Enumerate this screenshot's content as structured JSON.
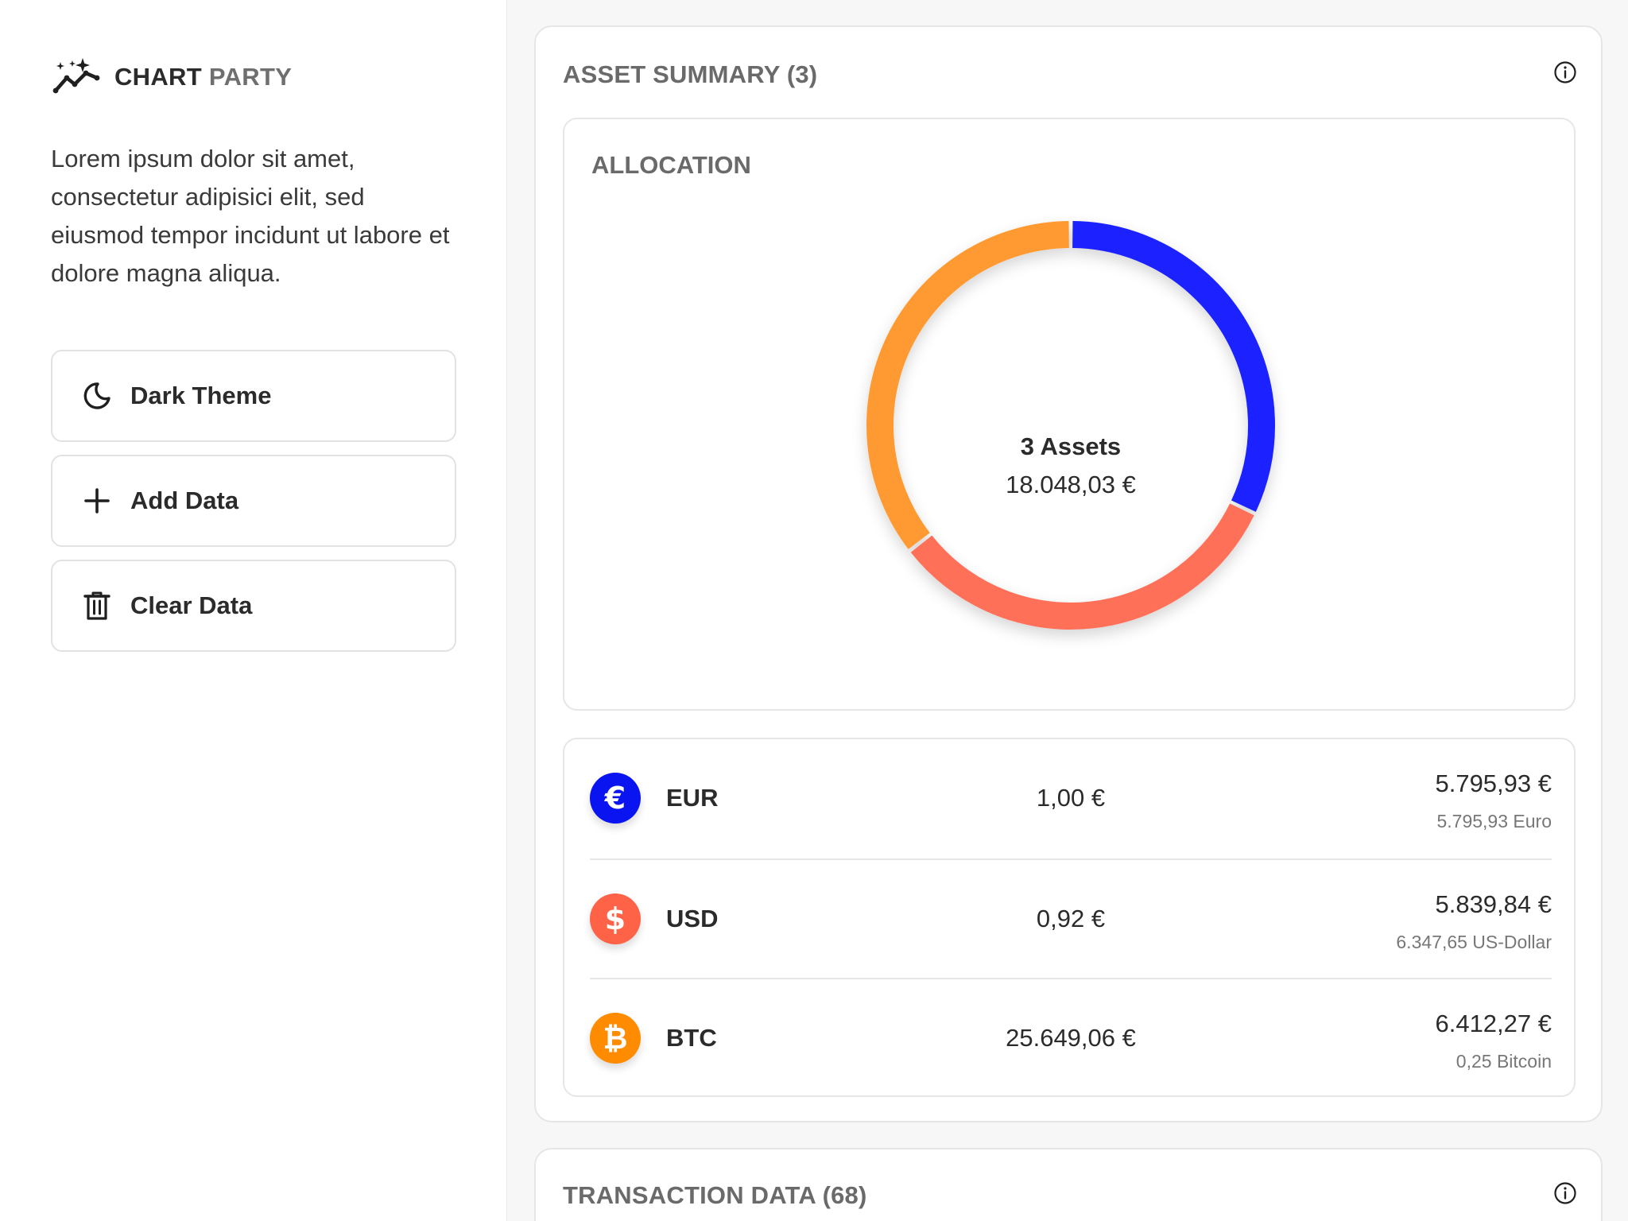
{
  "brand": {
    "name_first": "CHART",
    "name_second": " PARTY",
    "logo_icon": "sparkle-chart-line-icon"
  },
  "sidebar": {
    "description": "Lorem ipsum dolor sit amet, consectetur adipisici elit, sed eiusmod tempor incidunt ut labore et dolore magna aliqua.",
    "buttons": [
      {
        "label": "Dark Theme",
        "icon": "moon-icon"
      },
      {
        "label": "Add Data",
        "icon": "plus-icon"
      },
      {
        "label": "Clear Data",
        "icon": "trash-icon"
      }
    ]
  },
  "summary": {
    "title": "ASSET SUMMARY (3)",
    "allocation": {
      "title": "ALLOCATION",
      "center_title": "3 Assets",
      "center_value": "18.048,03 €"
    },
    "assets": [
      {
        "symbol": "EUR",
        "glyph": "€",
        "color": "#0a14f0",
        "rate": "1,00 €",
        "value": "5.795,93 €",
        "quantity": "5.795,93 Euro"
      },
      {
        "symbol": "USD",
        "glyph": "$",
        "color": "#ff6347",
        "rate": "0,92 €",
        "value": "5.839,84 €",
        "quantity": "6.347,65 US-Dollar"
      },
      {
        "symbol": "BTC",
        "glyph": "₿",
        "color": "#ff8c00",
        "rate": "25.649,06 €",
        "value": "6.412,27 €",
        "quantity": "0,25 Bitcoin"
      }
    ]
  },
  "transactions": {
    "title": "TRANSACTION DATA (68)"
  },
  "chart_data": {
    "type": "pie",
    "variant": "donut",
    "categories": [
      "EUR",
      "USD",
      "BTC"
    ],
    "values": [
      5795.93,
      5839.84,
      6412.27
    ],
    "colors": [
      "#1a22ff",
      "#ff6f59",
      "#ff9933"
    ],
    "center_label": "3 Assets",
    "center_value": "18.048,03 €"
  }
}
